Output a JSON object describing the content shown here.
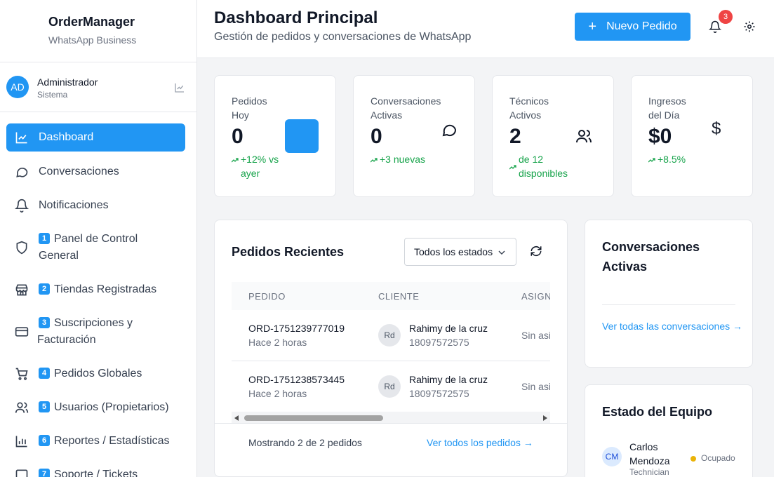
{
  "brand": {
    "title": "OrderManager",
    "subtitle": "WhatsApp Business"
  },
  "user": {
    "initials": "AD",
    "name": "Administrador",
    "role": "Sistema"
  },
  "nav": [
    {
      "label": "Dashboard",
      "active": true,
      "icon": "chart-line-icon"
    },
    {
      "label": "Conversaciones",
      "icon": "chat-bubble-icon"
    },
    {
      "label": "Notificaciones",
      "icon": "bell-icon"
    },
    {
      "badge": "1",
      "label": "Panel de Control General",
      "icon": "shield-icon"
    },
    {
      "badge": "2",
      "label": "Tiendas Registradas",
      "icon": "store-icon"
    },
    {
      "badge": "3",
      "label": "Suscripciones y Facturación",
      "icon": "credit-card-icon"
    },
    {
      "badge": "4",
      "label": "Pedidos Globales",
      "icon": "cart-icon"
    },
    {
      "badge": "5",
      "label": "Usuarios (Propietarios)",
      "icon": "users-icon"
    },
    {
      "badge": "6",
      "label": "Reportes / Estadísticas",
      "icon": "bar-chart-icon"
    },
    {
      "badge": "7",
      "label": "Soporte / Tickets",
      "icon": "message-square-icon"
    }
  ],
  "header": {
    "title": "Dashboard Principal",
    "subtitle": "Gestión de pedidos y conversaciones de WhatsApp",
    "new_order_label": "Nuevo Pedido",
    "notification_count": "3"
  },
  "stats": [
    {
      "label": "Pedidos Hoy",
      "value": "0",
      "trend": "+12% vs ayer"
    },
    {
      "label": "Conversaciones Activas",
      "value": "0",
      "trend": "+3 nuevas"
    },
    {
      "label": "Técnicos Activos",
      "value": "2",
      "trend": "de 12 disponibles"
    },
    {
      "label": "Ingresos del Día",
      "value": "$0",
      "trend": "+8.5%"
    }
  ],
  "orders": {
    "title": "Pedidos Recientes",
    "filter_value": "Todos los estados",
    "columns": [
      "PEDIDO",
      "CLIENTE",
      "ASIGN"
    ],
    "rows": [
      {
        "id": "ORD-1751239777019",
        "time": "Hace 2 horas",
        "client_initials": "Rd",
        "client_name": "Rahimy de la cruz",
        "client_phone": "18097572575",
        "assigned": "Sin asi"
      },
      {
        "id": "ORD-1751238573445",
        "time": "Hace 2 horas",
        "client_initials": "Rd",
        "client_name": "Rahimy de la cruz",
        "client_phone": "18097572575",
        "assigned": "Sin asi"
      }
    ],
    "showing_text": "Mostrando 2 de 2 pedidos",
    "see_all_text": "Ver todos los pedidos →"
  },
  "conversations": {
    "title": "Conversaciones Activas",
    "link": "Ver todas las conversaciones →"
  },
  "team": {
    "title": "Estado del Equipo",
    "members": [
      {
        "initials": "CM",
        "name": "Carlos Mendoza",
        "role": "Technician",
        "status": "Ocupado"
      }
    ]
  },
  "colors": {
    "primary": "#2196f3",
    "badge_red": "#ef4444",
    "trend_green": "#16a34a",
    "busy_yellow": "#eab308"
  }
}
